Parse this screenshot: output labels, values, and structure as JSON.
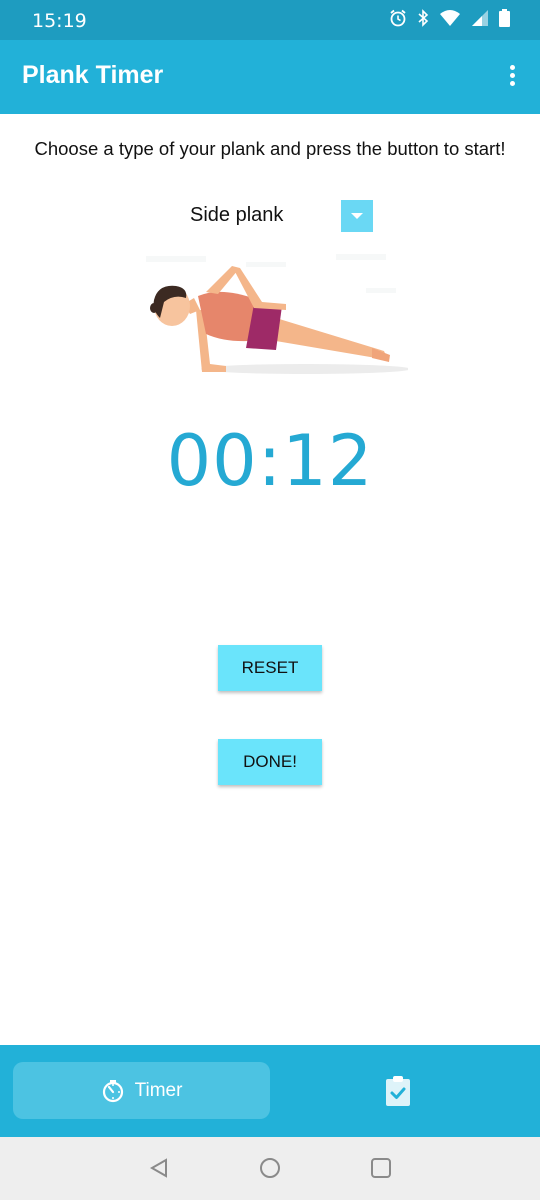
{
  "status_bar": {
    "time": "15:19"
  },
  "app_bar": {
    "title": "Plank Timer",
    "overflow_icon": "more-vert-icon"
  },
  "instruction": "Choose a type of your plank and press the button to start!",
  "plank_selector": {
    "selected": "Side plank",
    "arrow_icon": "dropdown-arrow-icon"
  },
  "timer": {
    "display": "00:12"
  },
  "buttons": {
    "reset_label": "RESET",
    "done_label": "DONE!"
  },
  "bottom_nav": {
    "items": [
      {
        "label": "Timer",
        "icon": "timer-icon",
        "active": true
      },
      {
        "label": "",
        "icon": "clipboard-check-icon",
        "active": false
      }
    ]
  },
  "colors": {
    "status_bar": "#1e9cc0",
    "app_bar": "#22b1d8",
    "accent_button": "#6ae4fb",
    "timer_text": "#25a9d3",
    "nav_active": "#4cc3e2"
  }
}
